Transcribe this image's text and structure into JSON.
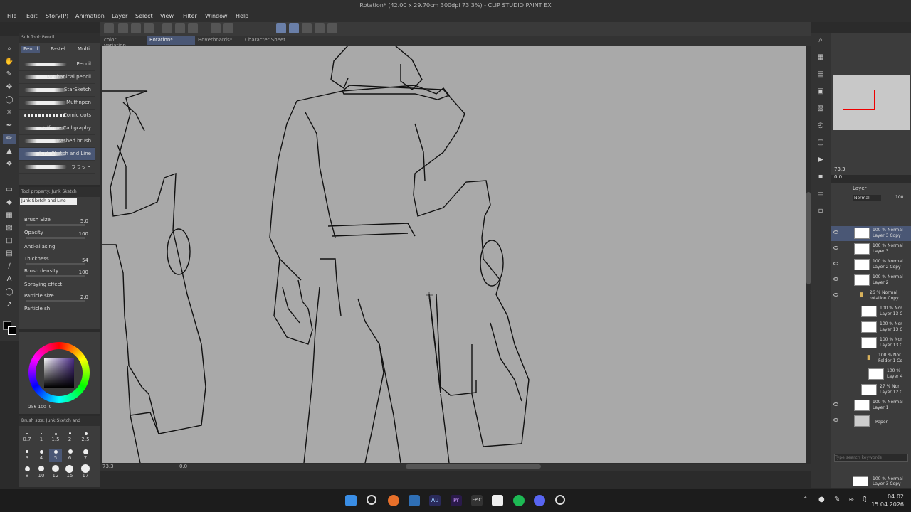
{
  "window": {
    "title": "Rotation* (42.00 x 29.70cm 300dpi 73.3%) - CLIP STUDIO PAINT EX"
  },
  "menu": [
    "File",
    "Edit",
    "Story(P)",
    "Animation",
    "Layer",
    "Select",
    "View",
    "Filter",
    "Window",
    "Help"
  ],
  "tabs": [
    {
      "label": "color variation...",
      "active": false
    },
    {
      "label": "Rotation*",
      "active": true
    },
    {
      "label": "Hoverboards*",
      "active": false
    },
    {
      "label": "Character Sheet",
      "active": false
    }
  ],
  "subtool": {
    "header": "Sub Tool: Pencil",
    "groups": [
      "Pencil",
      "Pastel",
      "Multi"
    ],
    "brushes": [
      "Pencil",
      "Mechanical pencil",
      "StarSketch",
      "Muffinpen",
      "Comic dots",
      "Halftone Calligraphy",
      "trashed brush",
      "Junk Sketch and Line",
      "フラット"
    ],
    "selected_index": 7
  },
  "toolprop": {
    "header": "Tool property: Junk Sketch",
    "preset": "Junk Sketch and Line",
    "props": [
      {
        "label": "Brush Size",
        "value": "5.0"
      },
      {
        "label": "Opacity",
        "value": "100"
      },
      {
        "label": "Anti-aliasing",
        "value": ""
      },
      {
        "label": "Thickness",
        "value": "54"
      },
      {
        "label": "Brush density",
        "value": "100"
      },
      {
        "label": "Spraying effect",
        "value": ""
      },
      {
        "label": "Particle size",
        "value": "2.0"
      },
      {
        "label": "Particle sh",
        "value": ""
      }
    ]
  },
  "color": {
    "hsv": "256",
    "s": "100",
    "v": "0",
    "accent": "#4a2a8a"
  },
  "brushsize": {
    "header": "Brush size: Junk Sketch and",
    "sizes": [
      "0.7",
      "1",
      "1.5",
      "2",
      "2.5",
      "3",
      "4",
      "5",
      "6",
      "7",
      "8",
      "10",
      "12",
      "15",
      "17"
    ],
    "selected": "5"
  },
  "status": {
    "zoom": "73.3",
    "angle": "0.0"
  },
  "layers": [
    {
      "line1": "100 % Normal",
      "line2": "Layer 3 Copy",
      "selected": true,
      "indent": 0
    },
    {
      "line1": "100 % Normal",
      "line2": "Layer 3",
      "selected": false,
      "indent": 0
    },
    {
      "line1": "100 % Normal",
      "line2": "Layer 2 Copy",
      "selected": false,
      "indent": 0
    },
    {
      "line1": "100 % Normal",
      "line2": "Layer 2",
      "selected": false,
      "indent": 0
    },
    {
      "line1": "26 % Normal",
      "line2": "rotation Copy",
      "selected": false,
      "indent": 1
    },
    {
      "line1": "100 % Nor",
      "line2": "Layer 13 C",
      "selected": false,
      "indent": 2
    },
    {
      "line1": "100 % Nor",
      "line2": "Layer 13 C",
      "selected": false,
      "indent": 2
    },
    {
      "line1": "100 % Nor",
      "line2": "Layer 13 C",
      "selected": false,
      "indent": 2
    },
    {
      "line1": "100 % Nor",
      "line2": "Folder 1 Co",
      "selected": false,
      "indent": 2
    },
    {
      "line1": "100 %",
      "line2": "Layer 4",
      "selected": false,
      "indent": 3
    },
    {
      "line1": "27 % Nor",
      "line2": "Layer 12 C",
      "selected": false,
      "indent": 2
    },
    {
      "line1": "100 % Normal",
      "line2": "Layer 1",
      "selected": false,
      "indent": 0
    },
    {
      "line1": "",
      "line2": "Paper",
      "selected": false,
      "indent": 0
    }
  ],
  "layerpanel": {
    "header": "Layer",
    "blend": "Normal",
    "opacity": "100",
    "zoom": "73.3",
    "rot": "0.0"
  },
  "search": {
    "placeholder": "Type search keywords",
    "bottom_line1": "100 % Normal",
    "bottom_line2": "Layer 3 Copy"
  },
  "taskbar": {
    "time": "04:02",
    "date": "15.04.2026"
  }
}
